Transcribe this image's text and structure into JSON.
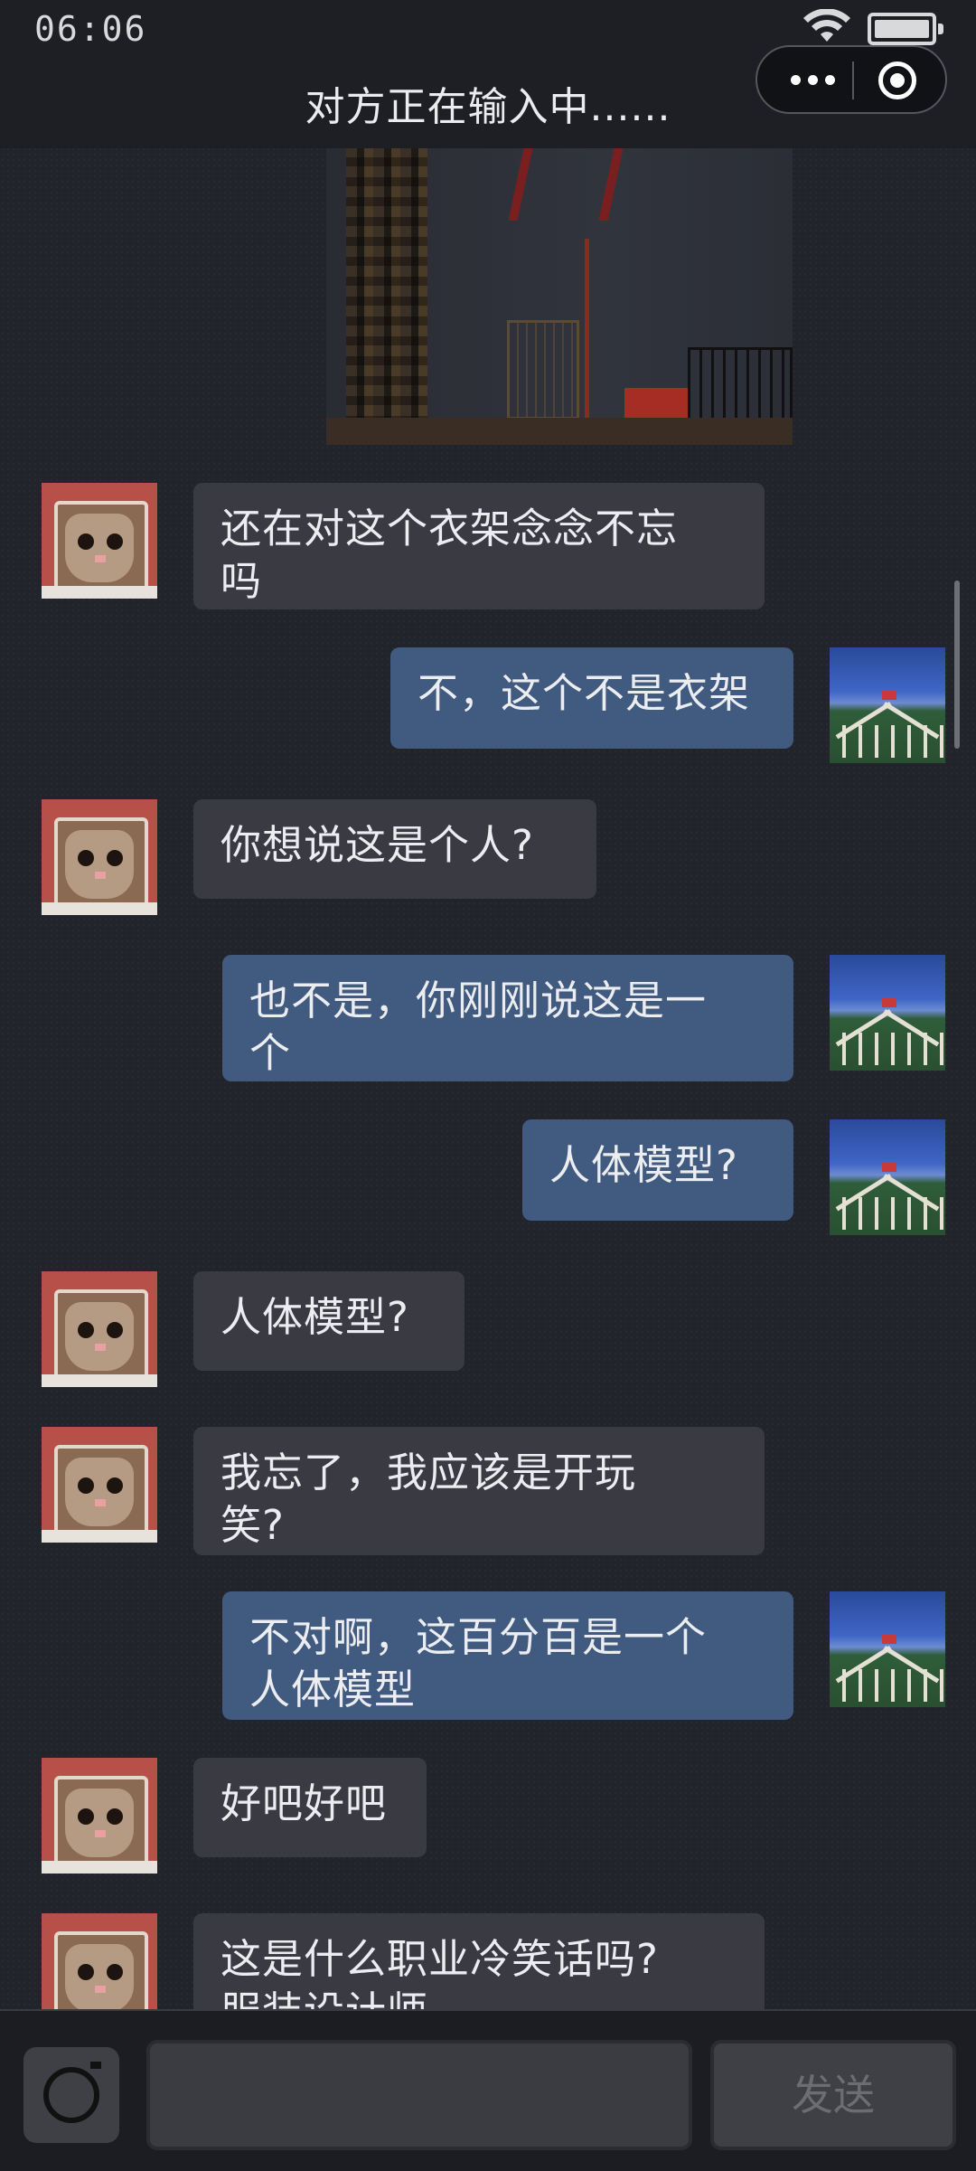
{
  "status_bar": {
    "time": "06:06"
  },
  "header": {
    "title": "对方正在输入中......"
  },
  "messages": [
    {
      "side": "left",
      "text": "还在对这个衣架念念不忘\n吗"
    },
    {
      "side": "right",
      "text": "不，这个不是衣架"
    },
    {
      "side": "left",
      "text": "你想说这是个人?"
    },
    {
      "side": "right",
      "text": "也不是，你刚刚说这是一\n个"
    },
    {
      "side": "right",
      "text": "人体模型?"
    },
    {
      "side": "left",
      "text": "人体模型?"
    },
    {
      "side": "left",
      "text": "我忘了，我应该是开玩\n笑?"
    },
    {
      "side": "right",
      "text": "不对啊，这百分百是一个\n人体模型"
    },
    {
      "side": "left",
      "text": "好吧好吧"
    },
    {
      "side": "left",
      "text": "这是什么职业冷笑话吗?\n服装设计师"
    }
  ],
  "composer": {
    "input_value": "",
    "send_label": "发送"
  },
  "icons": {
    "wifi": "wifi-icon",
    "battery": "battery-icon",
    "more": "more-icon",
    "close": "close-icon",
    "camera": "camera-icon"
  },
  "colors": {
    "incoming_bubble": "#3a3b42",
    "outgoing_bubble": "#415a80",
    "background": "#22242b"
  }
}
